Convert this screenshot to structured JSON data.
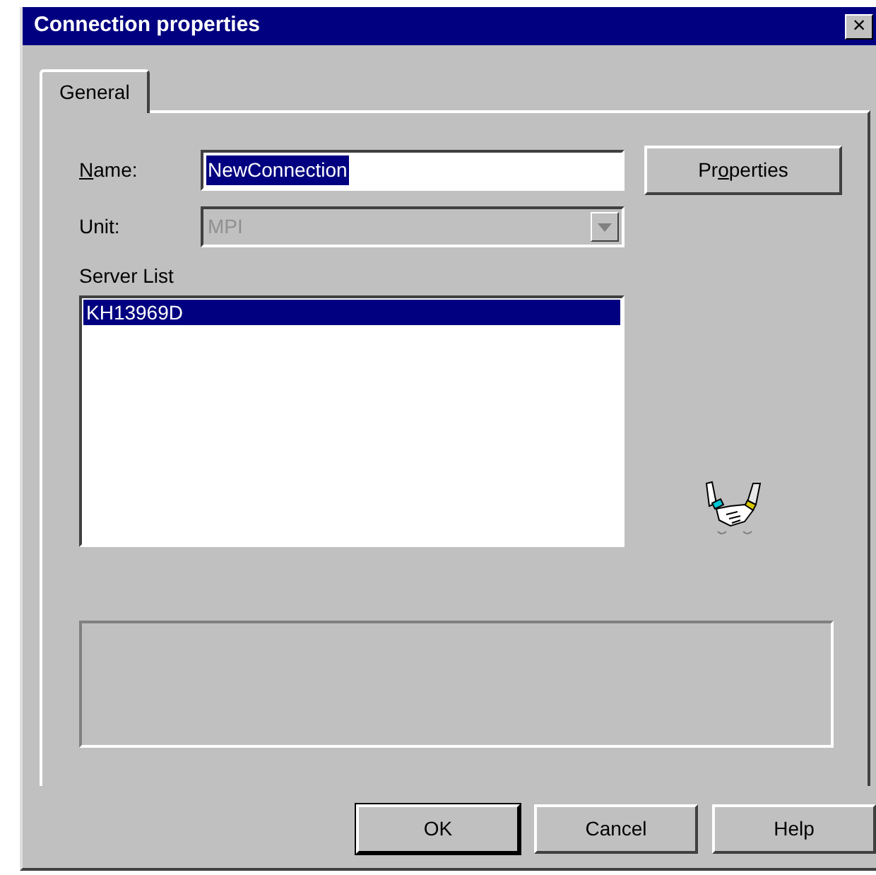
{
  "window": {
    "title": "Connection properties",
    "close": "×"
  },
  "tabs": [
    {
      "label": "General",
      "selected": true
    }
  ],
  "name_field": {
    "label": [
      {
        "text": "N",
        "underlined": true
      },
      {
        "text": "ame:",
        "underlined": false
      }
    ],
    "value": "NewConnection",
    "text_selected": true
  },
  "properties_button": {
    "label": [
      {
        "text": "Pr",
        "underlined": false
      },
      {
        "text": "o",
        "underlined": true
      },
      {
        "text": "perties",
        "underlined": false
      }
    ]
  },
  "unit_field": {
    "label": "Unit:",
    "value": "MPI",
    "disabled": true
  },
  "server_list": {
    "label": "Server List",
    "items": [
      {
        "label": "KH13969D",
        "selected": true
      }
    ]
  },
  "buttons": [
    {
      "label": "OK",
      "default": true
    },
    {
      "label": "Cancel",
      "default": false
    },
    {
      "label": "Help",
      "default": false
    }
  ]
}
